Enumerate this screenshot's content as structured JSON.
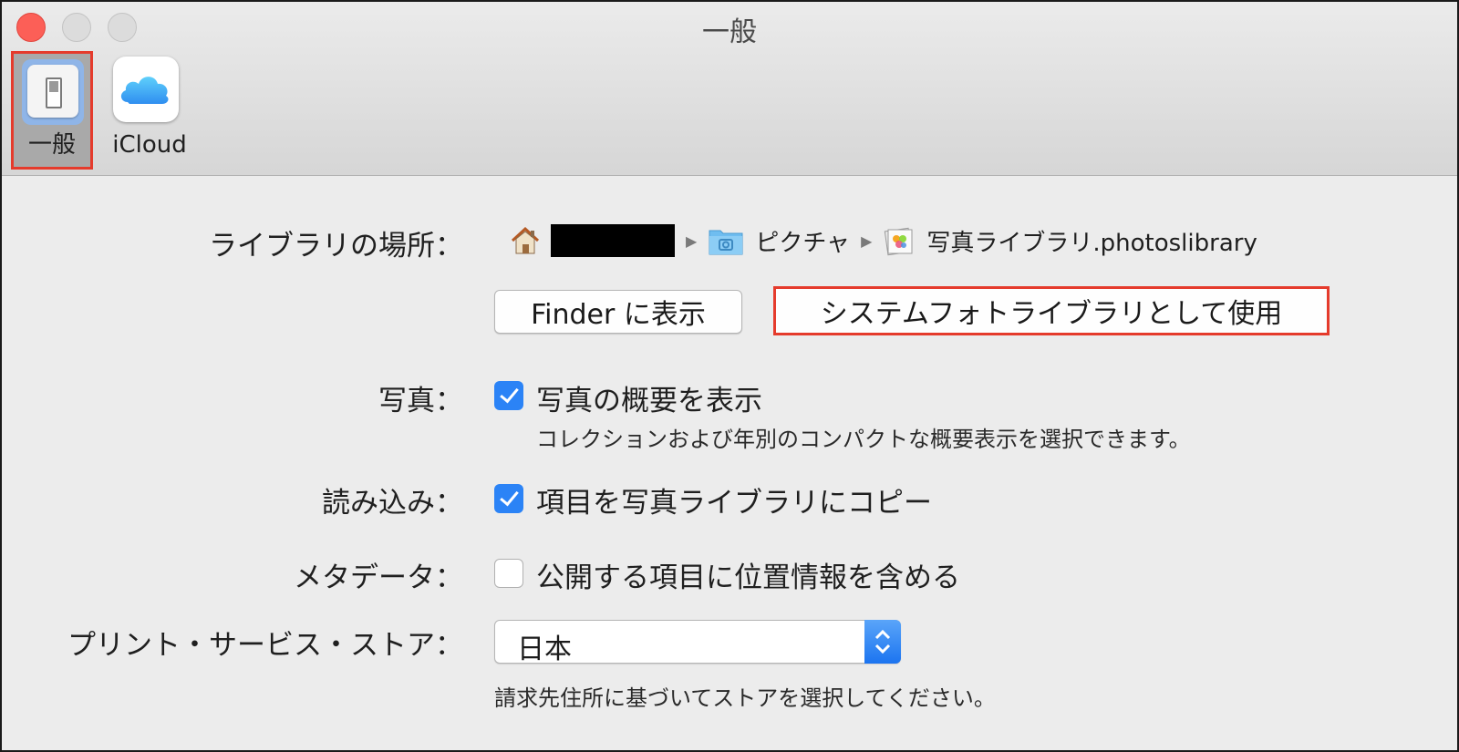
{
  "window": {
    "title": "一般"
  },
  "toolbar": {
    "tabs": [
      {
        "label": "一般",
        "icon": "general-switch-icon",
        "selected": true
      },
      {
        "label": "iCloud",
        "icon": "icloud-icon",
        "selected": false
      }
    ]
  },
  "library": {
    "label": "ライブラリの場所：",
    "path": [
      {
        "icon": "home-icon",
        "text": ""
      },
      {
        "icon": "pictures-folder-icon",
        "text": "ピクチャ"
      },
      {
        "icon": "photos-library-icon",
        "text": "写真ライブラリ.photoslibrary"
      }
    ],
    "finder_button": "Finder に表示",
    "system_button": "システムフォトライブラリとして使用"
  },
  "photos": {
    "label": "写真：",
    "checkbox_label": "写真の概要を表示",
    "checked": true,
    "help": "コレクションおよび年別のコンパクトな概要表示を選択できます。"
  },
  "import": {
    "label": "読み込み：",
    "checkbox_label": "項目を写真ライブラリにコピー",
    "checked": true
  },
  "metadata": {
    "label": "メタデータ：",
    "checkbox_label": "公開する項目に位置情報を含める",
    "checked": false
  },
  "print_store": {
    "label": "プリント・サービス・ストア：",
    "selected": "日本",
    "help": "請求先住所に基づいてストアを選択してください。"
  },
  "colors": {
    "accent": "#2b83f6",
    "highlight": "#e53b2c",
    "close_button": "#fc5f57"
  }
}
